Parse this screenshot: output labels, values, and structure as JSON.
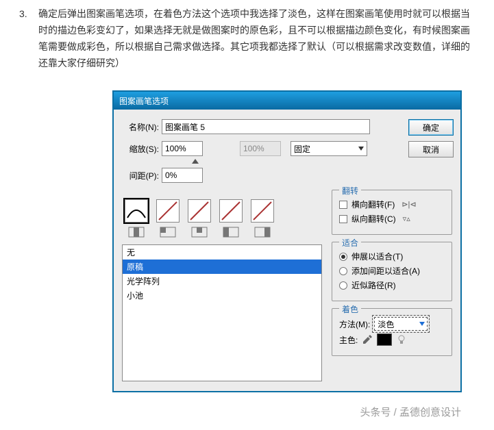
{
  "list": {
    "num": "3.",
    "text": "确定后弹出图案画笔选项，在着色方法这个选项中我选择了淡色，这样在图案画笔使用时就可以根据当时的描边色彩变幻了，如果选择无就是做图案时的原色彩，且不可以根据描边颜色变化，有时候图案画笔需要做成彩色，所以根据自己需求做选择。其它项我都选择了默认（可以根据需求改变数值，详细的还靠大家仔细研究）"
  },
  "dialog": {
    "title": "图案画笔选项",
    "name_label": "名称(N):",
    "name_value": "图案画笔 5",
    "scale_label": "缩放(S):",
    "scale_value": "100%",
    "scale_value2": "100%",
    "fixed_label": "固定",
    "gap_label": "间距(P):",
    "gap_value": "0%",
    "ok": "确定",
    "cancel": "取消",
    "flip": {
      "title": "翻转",
      "h": "横向翻转(F)",
      "v": "纵向翻转(C)"
    },
    "fit": {
      "title": "适合",
      "r1": "伸展以适合(T)",
      "r2": "添加间距以适合(A)",
      "r3": "近似路径(R)"
    },
    "color": {
      "title": "着色",
      "method_label": "方法(M):",
      "method_value": "淡色",
      "main_label": "主色:"
    },
    "listbox": [
      "无",
      "原稿",
      "光学阵列",
      "小池"
    ]
  },
  "footer": "头条号 / 孟德创意设计"
}
